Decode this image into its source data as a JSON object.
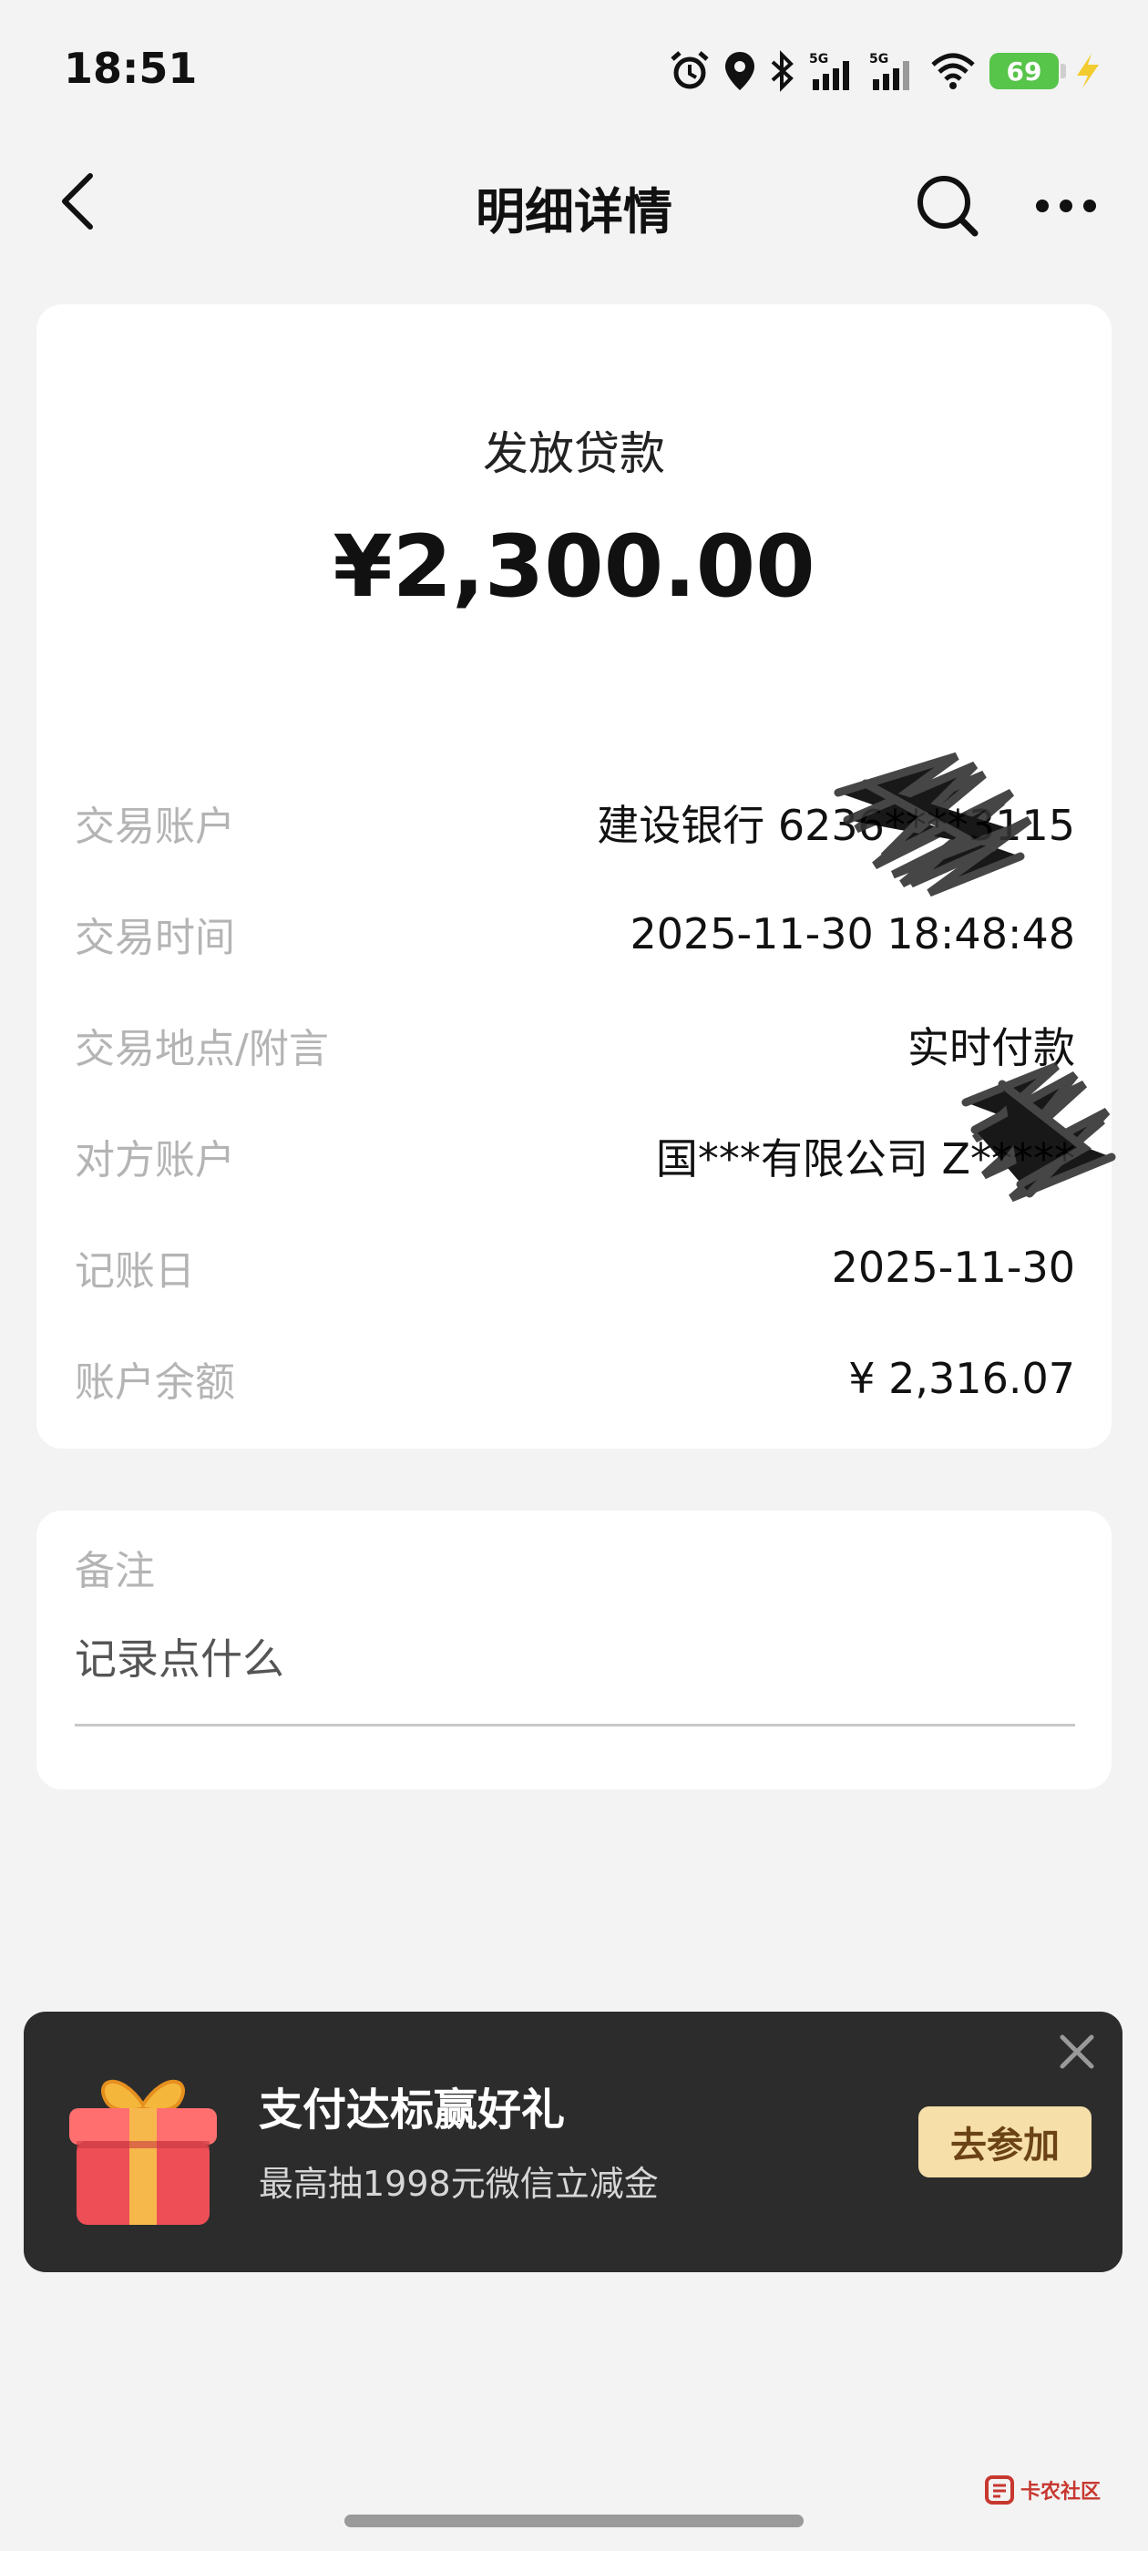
{
  "status_bar": {
    "time": "18:51",
    "battery": "69",
    "signal_1": "5G",
    "signal_2": "5G"
  },
  "nav": {
    "title": "明细详情"
  },
  "detail": {
    "type": "发放贷款",
    "amount": "¥2,300.00",
    "rows": [
      {
        "label": "交易账户",
        "value": "建设银行 6236****3115"
      },
      {
        "label": "交易时间",
        "value": "2025-11-30 18:48:48"
      },
      {
        "label": "交易地点/附言",
        "value": "实时付款"
      },
      {
        "label": "对方账户",
        "value": "国***有限公司 Z*****"
      },
      {
        "label": "记账日",
        "value": "2025-11-30"
      },
      {
        "label": "账户余额",
        "value": "¥ 2,316.07"
      }
    ]
  },
  "remark": {
    "label": "备注",
    "placeholder": "记录点什么"
  },
  "promo": {
    "title": "支付达标赢好礼",
    "subtitle": "最高抽1998元微信立减金",
    "button": "去参加"
  },
  "watermark": {
    "text": "卡农社区"
  }
}
